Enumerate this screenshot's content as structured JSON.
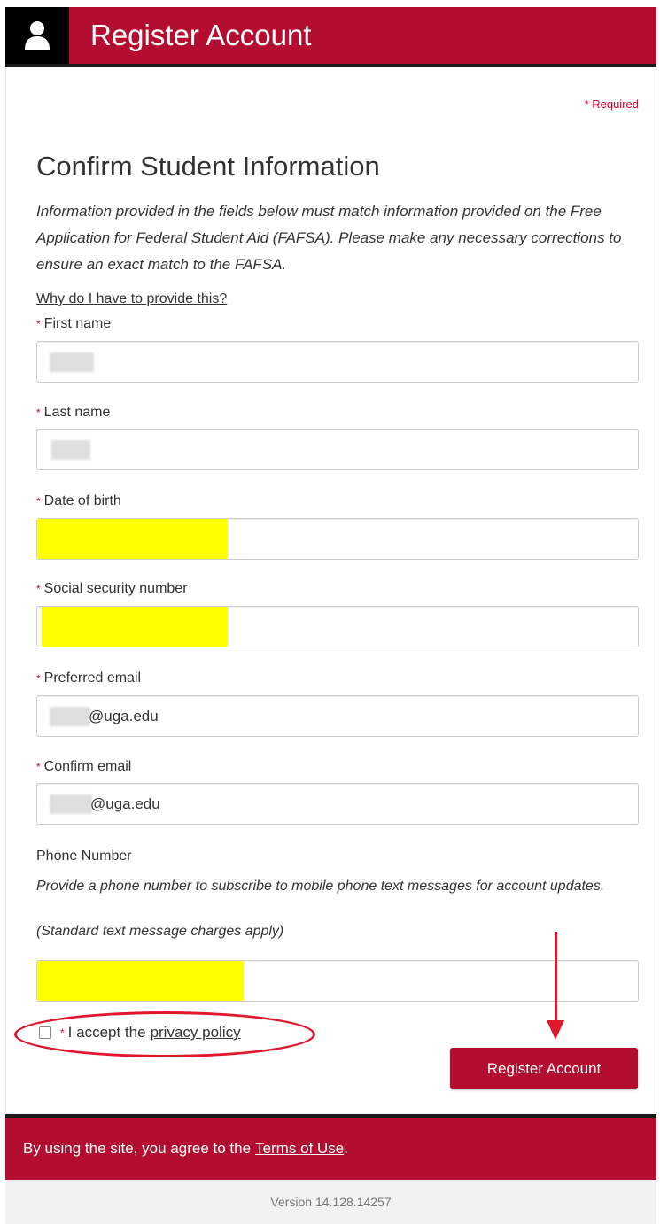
{
  "header": {
    "icon": "user-icon",
    "title": "Register Account"
  },
  "required_note": "* Required",
  "section": {
    "title": "Confirm Student Information",
    "intro": "Information provided in the fields below must match information provided on the Free Application for Federal Student Aid (FAFSA). Please make any necessary corrections to ensure an exact match to the FAFSA.",
    "why_link": "Why do I have to provide this?"
  },
  "fields": {
    "required_marker": "*",
    "first_name": {
      "label": "First name",
      "value": ""
    },
    "last_name": {
      "label": "Last name",
      "value": ""
    },
    "date_of_birth": {
      "label": "Date of birth",
      "value": ""
    },
    "ssn": {
      "label": "Social security number",
      "value": ""
    },
    "preferred_email": {
      "label": "Preferred email",
      "value": "@uga.edu"
    },
    "confirm_email": {
      "label": "Confirm email",
      "value": "@uga.edu"
    }
  },
  "phone": {
    "label": "Phone Number",
    "help": "Provide a phone number to subscribe to mobile phone text messages for account updates.",
    "note": "(Standard text message charges apply)",
    "value": ""
  },
  "privacy": {
    "prefix": "I accept the",
    "link": "privacy policy",
    "checked": false
  },
  "register_button": "Register Account",
  "footer": {
    "text": "By using the site, you agree to the",
    "link": "Terms of Use",
    "suffix": "."
  },
  "version": "Version 14.128.14257",
  "colors": {
    "brand": "#b30e2f",
    "required": "#d9002b",
    "annotation": "#e0182d",
    "redaction": "#ffff00"
  }
}
